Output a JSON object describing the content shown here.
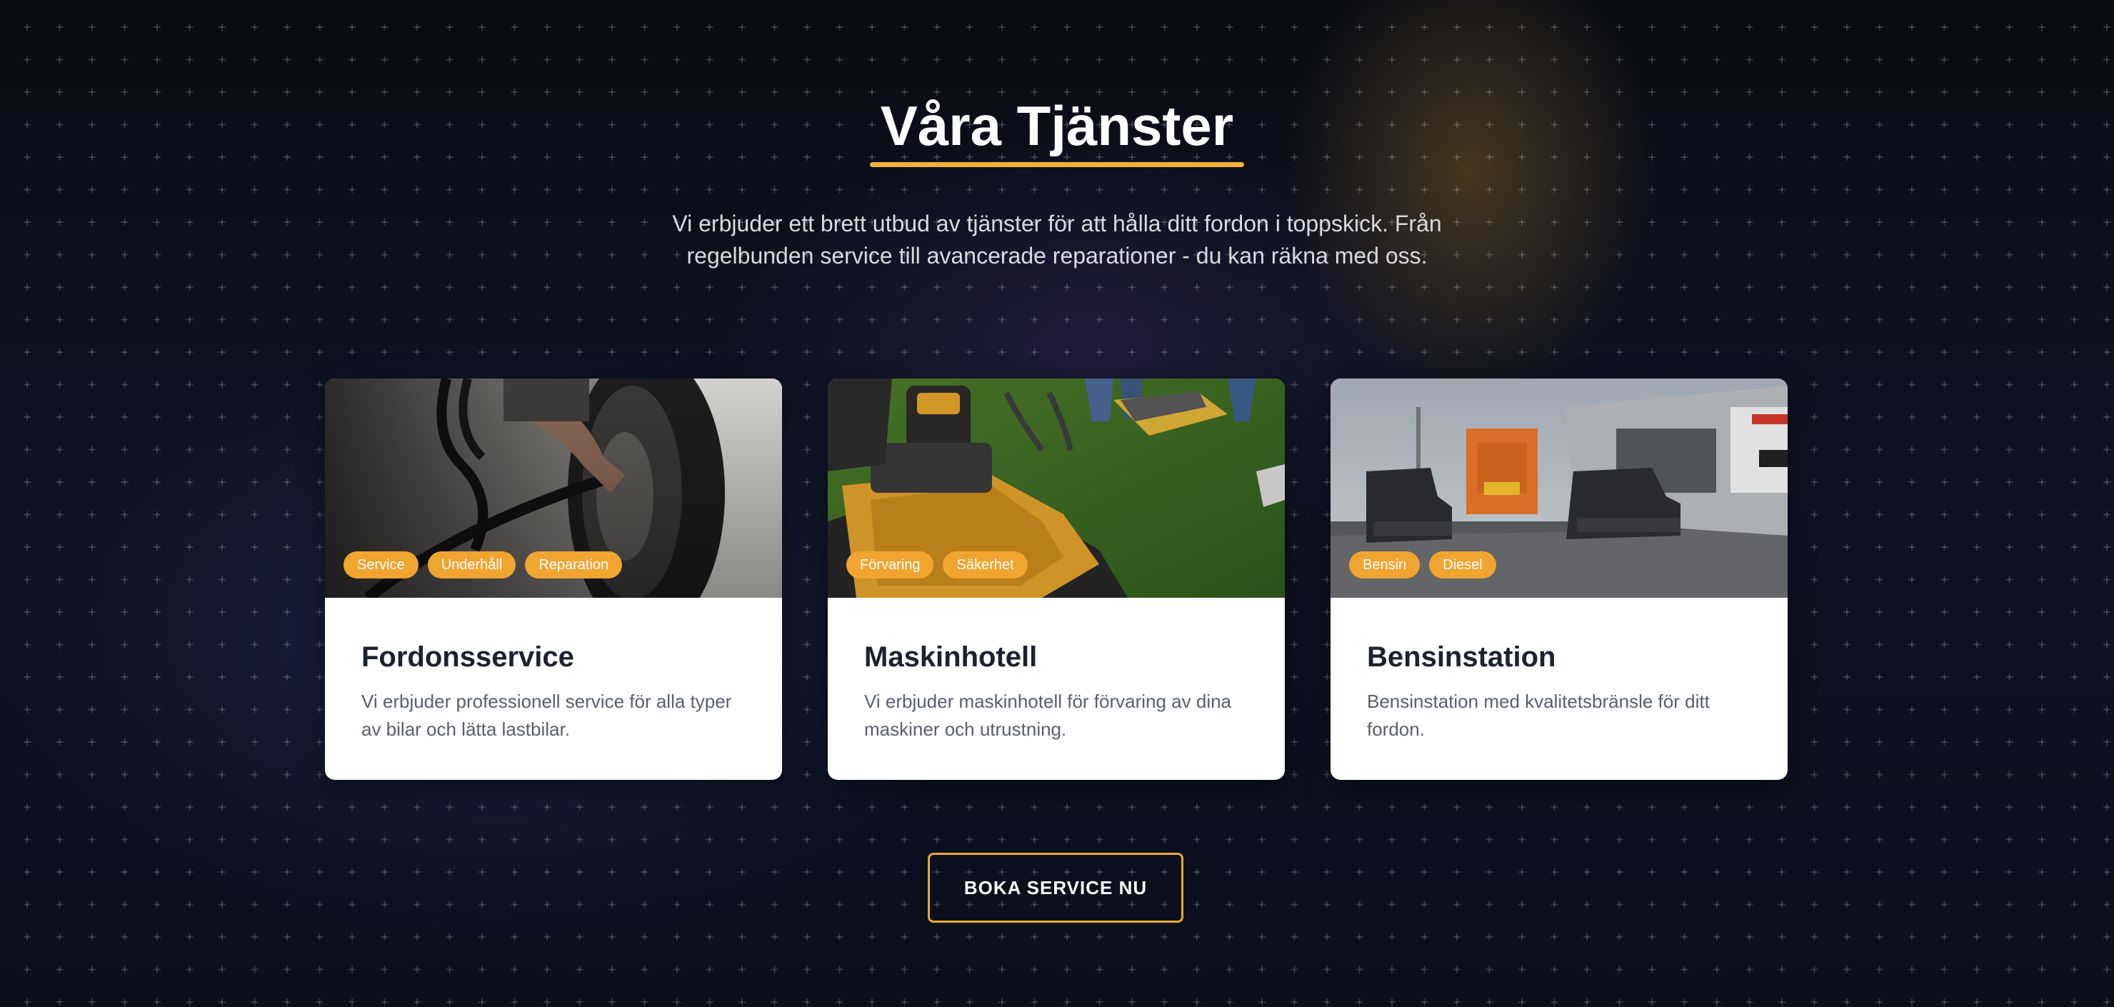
{
  "section": {
    "title": "Våra Tjänster",
    "subtitle": "Vi erbjuder ett brett utbud av tjänster för att hålla ditt fordon i toppskick. Från regelbunden service till avancerade reparationer - du kan räkna med oss."
  },
  "cards": [
    {
      "title": "Fordonsservice",
      "description": "Vi erbjuder professionell service för alla typer av bilar och lätta lastbilar.",
      "tags": [
        "Service",
        "Underhåll",
        "Reparation"
      ],
      "image_icon": "tire-service-photo"
    },
    {
      "title": "Maskinhotell",
      "description": "Vi erbjuder maskinhotell för förvaring av dina maskiner och utrustning.",
      "tags": [
        "Förvaring",
        "Säkerhet"
      ],
      "image_icon": "lawn-mower-photo"
    },
    {
      "title": "Bensinstation",
      "description": "Bensinstation med kvalitetsbränsle för ditt fordon.",
      "tags": [
        "Bensin",
        "Diesel"
      ],
      "image_icon": "gas-station-photo"
    }
  ],
  "cta": {
    "label": "BOKA SERVICE NU"
  },
  "colors": {
    "accent": "#f0a530",
    "underline": "#f2b13a",
    "background": "#0b0f1c",
    "card_title": "#1d2230",
    "card_text": "#5a5f6b"
  }
}
